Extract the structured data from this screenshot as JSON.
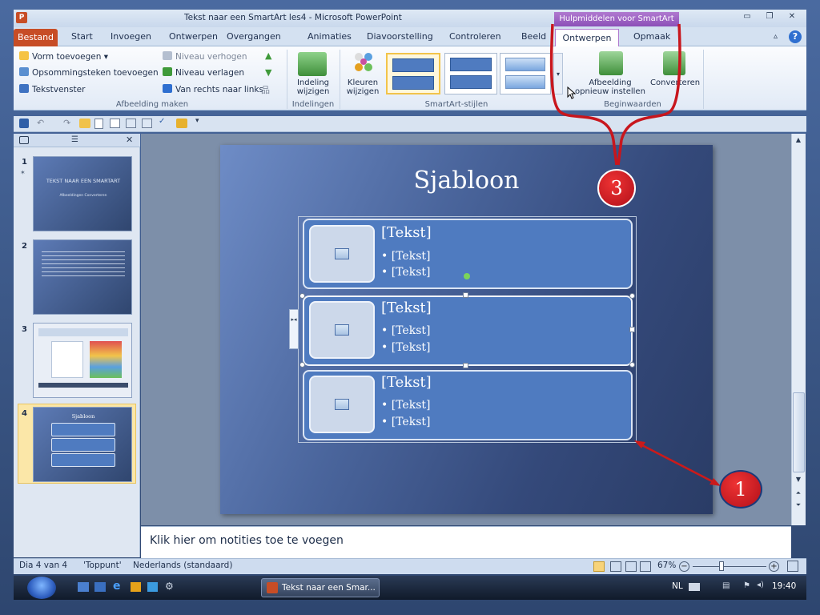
{
  "window": {
    "title": "Tekst naar een SmartArt les4  -  Microsoft PowerPoint",
    "contextual_tab_group": "Hulpmiddelen voor SmartArt"
  },
  "tabs": [
    "Bestand",
    "Start",
    "Invoegen",
    "Ontwerpen",
    "Overgangen",
    "Animaties",
    "Diavoorstelling",
    "Controleren",
    "Beeld",
    "Ontwerpen",
    "Opmaak"
  ],
  "ribbon": {
    "create_graphic": {
      "add_shape": "Vorm toevoegen",
      "add_bullet": "Opsommingsteken toevoegen",
      "text_pane": "Tekstvenster",
      "promote": "Niveau verhogen",
      "demote": "Niveau verlagen",
      "right_to_left": "Van rechts naar links",
      "label": "Afbeelding maken"
    },
    "layouts": {
      "change_layout": "Indeling wijzigen",
      "label": "Indelingen"
    },
    "styles": {
      "change_colors": "Kleuren wijzigen",
      "label": "SmartArt-stijlen"
    },
    "reset": {
      "reset_graphic": "Afbeelding opnieuw instellen",
      "convert": "Converteren",
      "label": "Beginwaarden"
    }
  },
  "slides_pane": {
    "slides": [
      {
        "num": "1",
        "title": "TEKST NAAR EEN SMARTART",
        "subtitle": "Afbeeldingen Converteren"
      },
      {
        "num": "2"
      },
      {
        "num": "3"
      },
      {
        "num": "4",
        "title": "Sjabloon"
      }
    ]
  },
  "slide": {
    "title": "Sjabloon",
    "items": [
      {
        "heading": "[Tekst]",
        "bullets": [
          "• [Tekst]",
          "• [Tekst]"
        ]
      },
      {
        "heading": "[Tekst]",
        "bullets": [
          "• [Tekst]",
          "• [Tekst]"
        ]
      },
      {
        "heading": "[Tekst]",
        "bullets": [
          "• [Tekst]",
          "• [Tekst]"
        ]
      }
    ]
  },
  "annotations": {
    "callout_3": "3",
    "callout_1": "1",
    "accent_color": "#c8161d",
    "arrow_color": "#cc1a1a"
  },
  "notes": "Klik hier om notities toe te voegen",
  "status": {
    "slide_info": "Dia 4 van 4",
    "theme": "'Toppunt'",
    "language": "Nederlands (standaard)",
    "zoom": "67%"
  },
  "taskbar": {
    "app_button": "Tekst naar een Smar...",
    "lang": "NL",
    "time": "19:40"
  },
  "colors": {
    "file_tab": "#c74d26",
    "context_group": "#9a5ec4",
    "slide_bg": "#3e5688",
    "smartart_fill": "#4f7bc0"
  }
}
